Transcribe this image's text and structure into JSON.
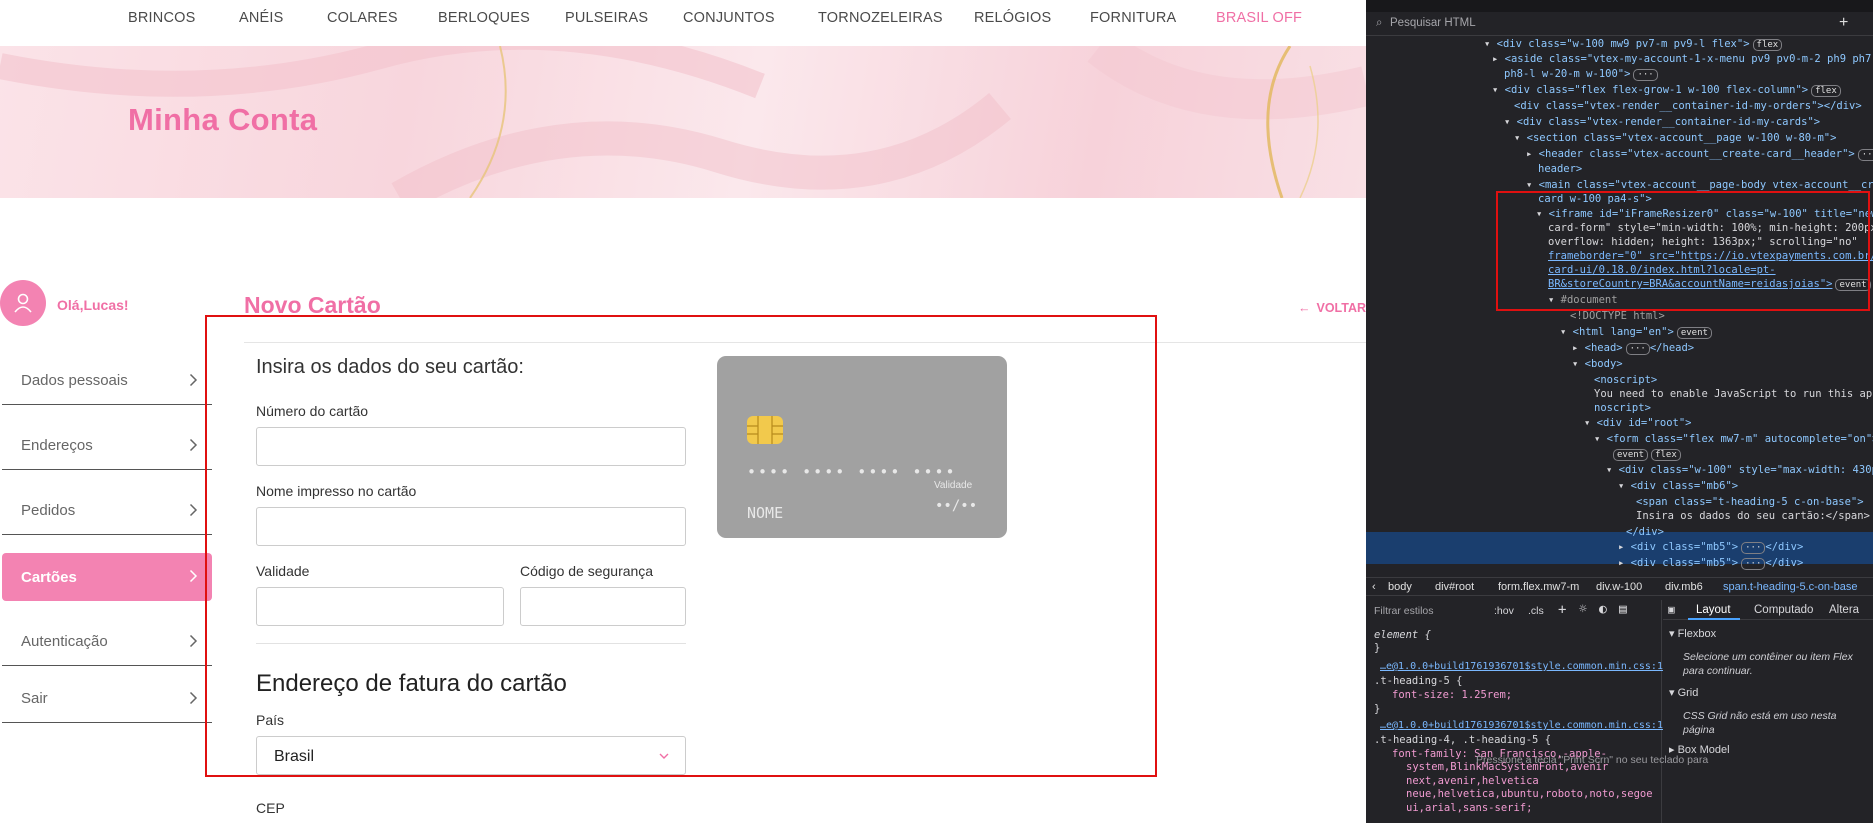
{
  "nav": {
    "items": [
      "BRINCOS",
      "ANÉIS",
      "COLARES",
      "BERLOQUES",
      "PULSEIRAS",
      "CONJUNTOS",
      "TORNOZELEIRAS",
      "RELÓGIOS",
      "FORNITURA",
      "BRASIL OFF"
    ]
  },
  "banner": {
    "title": "Minha Conta"
  },
  "account": {
    "greeting": "Olá,Lucas!",
    "menu": [
      "Dados pessoais",
      "Endereços",
      "Pedidos",
      "Cartões",
      "Autenticação",
      "Sair"
    ],
    "active": "Cartões"
  },
  "main": {
    "title": "Novo Cartão",
    "back": "VOLTAR"
  },
  "form": {
    "heading": "Insira os dados do seu cartão:",
    "card_number_label": "Número do cartão",
    "card_name_label": "Nome impresso no cartão",
    "validity_label": "Validade",
    "cvv_label": "Código de segurança",
    "billing_heading": "Endereço de fatura do cartão",
    "country_label": "País",
    "country_value": "Brasil",
    "cep_label": "CEP"
  },
  "card_preview": {
    "number": "•••• •••• •••• ••••",
    "name": "NOME",
    "validity_label": "Validade",
    "validity": "••/••"
  },
  "colors": {
    "accent": "#f06fa5",
    "highlight_box": "#e01010"
  },
  "devtools": {
    "search_placeholder": "Pesquisar HTML",
    "tree": [
      "<div class=\"w-100 mw9 pv7-m pv9-l flex\">",
      "<aside class=\"vtex-my-account-1-x-menu pv9 pv0-m-2 ph9 ph7-m",
      "ph8-l w-20-m w-100\">",
      "<div class=\"flex flex-grow-1 w-100 flex-column\">",
      "<div class=\"vtex-render__container-id-my-orders\"></div>",
      "<div class=\"vtex-render__container-id-my-cards\">",
      "<section class=\"vtex-account__page w-100 w-80-m\">",
      "<header class=\"vtex-account__create-card__header\">",
      "header>",
      "<main class=\"vtex-account__page-body vtex-account__crea",
      "card w-100 pa4-s\">",
      "<iframe id=\"iFrameResizer0\" class=\"w-100\" title=\"new-",
      "card-form\" style=\"min-width: 100%; min-height: 200px;",
      "overflow: hidden; height: 1363px;\" scrolling=\"no\"",
      "frameborder=\"0\" src=\"https://io.vtexpayments.com.br/ne",
      "card-ui/0.18.0/index.html?locale=pt-",
      "BR&storeCountry=BRA&accountName=reidasjoias\">",
      "#document",
      "<!DOCTYPE html>",
      "<html lang=\"en\">",
      "<head>",
      "</head>",
      "<body>",
      "<noscript>",
      "You need to enable JavaScript to run this app.",
      "noscript>",
      "<div id=\"root\">",
      "<form class=\"flex mw7-m\" autocomplete=\"on\">",
      "<div class=\"w-100\" style=\"max-width: 430px;",
      "<div class=\"mb6\">",
      "<span class=\"t-heading-5 c-on-base\">",
      "Insira os dados do seu cartão:</span>",
      "</div>",
      "<div class=\"mb5\">",
      "</div>"
    ],
    "badges": {
      "flex": "flex",
      "event": "event",
      "more": "···"
    },
    "breadcrumb": [
      "body",
      "div#root",
      "form.flex.mw7-m",
      "div.w-100",
      "div.mb6",
      "span.t-heading-5.c-on-base"
    ],
    "styles_filter": "Filtrar estilos",
    "styles_buttons": [
      ":hov",
      ".cls"
    ],
    "rules": [
      "element",
      "…e@1.0.0+build1761936701$style.common.min.css:1",
      ".t-heading-5",
      "font-size: 1.25rem;",
      ".t-heading-4, .t-heading-5",
      "font-family: San Francisco,-apple-",
      "system,BlinkMacSystemFont,avenir",
      "next,avenir,helvetica",
      "neue,helvetica,ubuntu,roboto,noto,segoe",
      "ui,arial,sans-serif;"
    ],
    "layout_tabs": [
      "Layout",
      "Computado",
      "Altera"
    ],
    "flexbox_title": "Flexbox",
    "flexbox_text": "Selecione um contêiner ou item Flex para continuar.",
    "grid_title": "Grid",
    "grid_text": "CSS Grid não está em uso nesta página",
    "boxmodel_title": "Box Model",
    "hint_text": "Pressione a tecla \"Print Scrn\" no seu teclado para"
  }
}
